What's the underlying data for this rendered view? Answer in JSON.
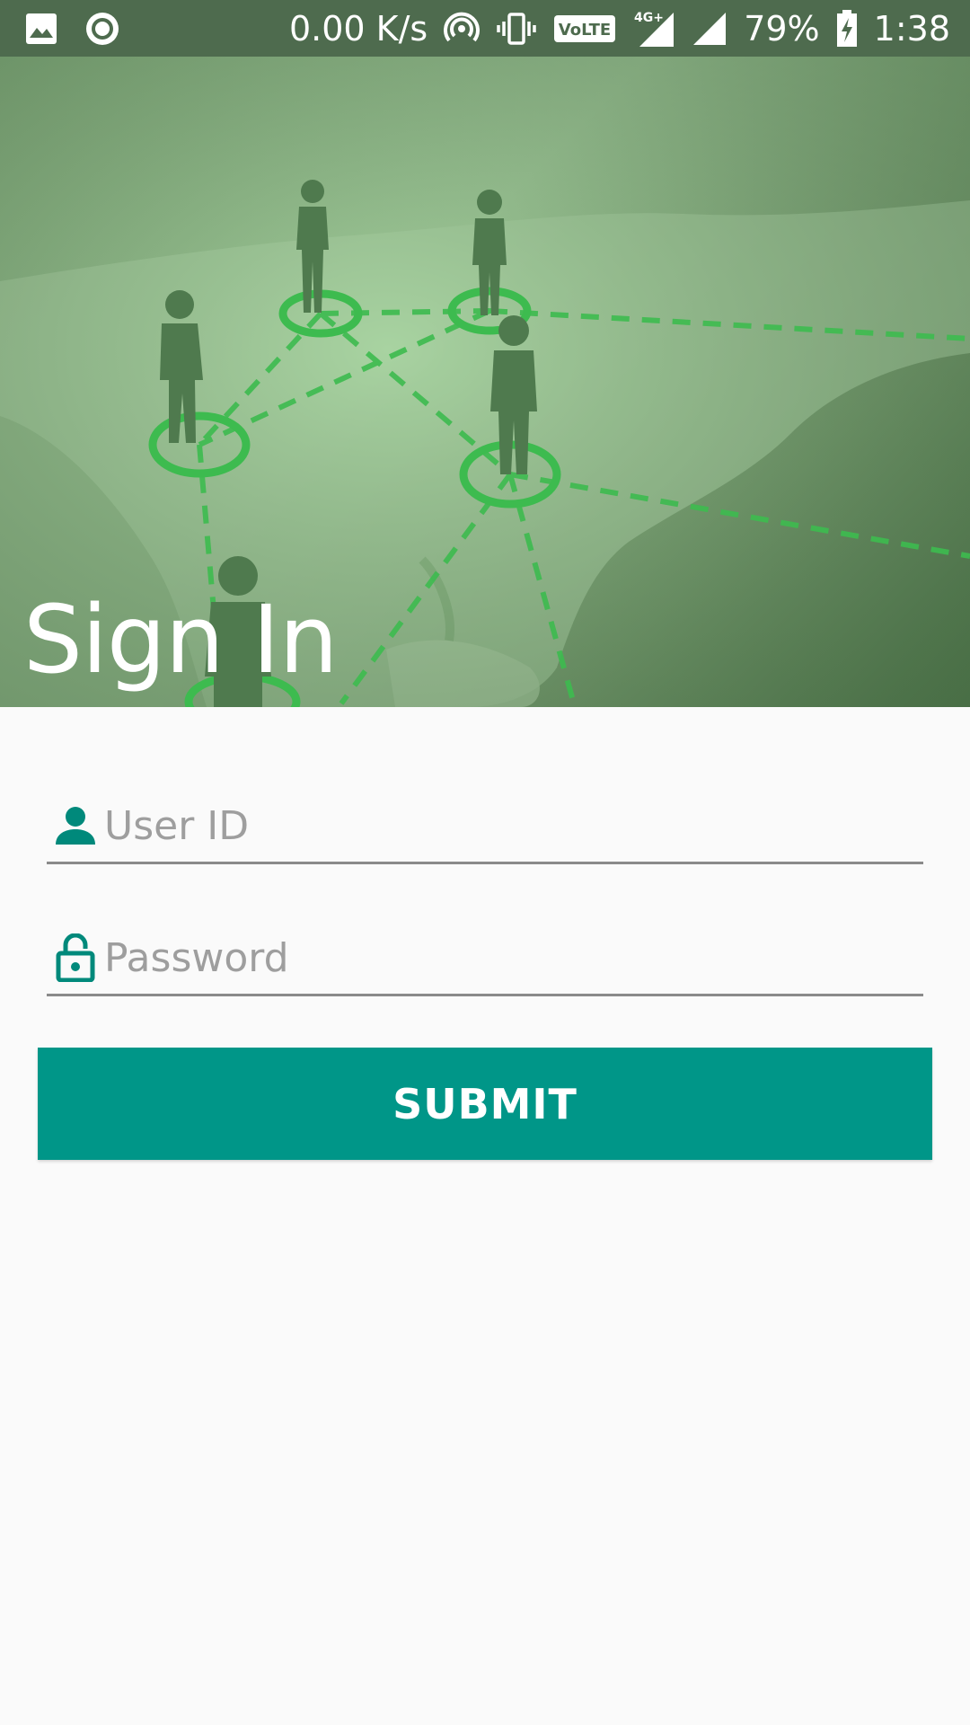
{
  "status_bar": {
    "icons_left": [
      "image-notification-icon",
      "record-notification-icon"
    ],
    "network_speed": "0.00 K/s",
    "volte_label": "VoLTE",
    "network_type": "4G+",
    "battery_percent": "79%",
    "time": "1:38",
    "icons_right": [
      "hotspot-icon",
      "vibrate-icon",
      "volte-icon",
      "signal-4g-icon",
      "signal-icon",
      "battery-charging-icon"
    ]
  },
  "hero": {
    "title": "Sign In",
    "image": "people-network-map-illustration"
  },
  "form": {
    "user_id": {
      "placeholder": "User ID",
      "value": "",
      "icon": "person-icon"
    },
    "password": {
      "placeholder": "Password",
      "value": "",
      "icon": "lock-open-icon"
    },
    "submit_label": "SUBMIT"
  },
  "colors": {
    "status_bar": "#4e6b4e",
    "accent": "#009688",
    "background": "#fafafa",
    "hero_green": "#a3cf9c",
    "network_line": "#3dbb4f"
  }
}
